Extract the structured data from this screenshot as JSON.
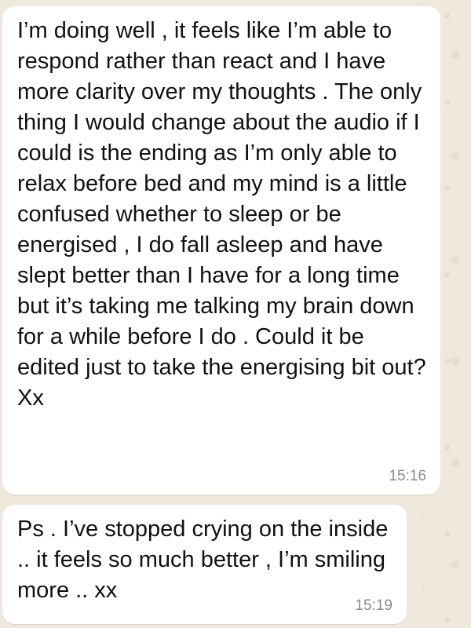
{
  "messages": [
    {
      "text": "I’m doing well , it feels like I’m able to respond rather than react and I have more clarity over my thoughts .  The only thing I would change about the audio if I could is the ending as I’m only able to relax before bed and my mind is a little confused whether to sleep or be energised , I do fall asleep and have slept better than I have for a long time but it’s taking me talking my brain down for a while before I do . Could it be edited just to take the energising bit out? Xx",
      "time": "15:16"
    },
    {
      "text": "Ps . I’ve stopped crying on the inside .. it feels so much better , I’m smiling more .. xx",
      "time": "15:19"
    }
  ],
  "colors": {
    "bubble": "#ffffff",
    "wallpaper": "#efe8dd",
    "timestamp": "#8a8a8a"
  }
}
